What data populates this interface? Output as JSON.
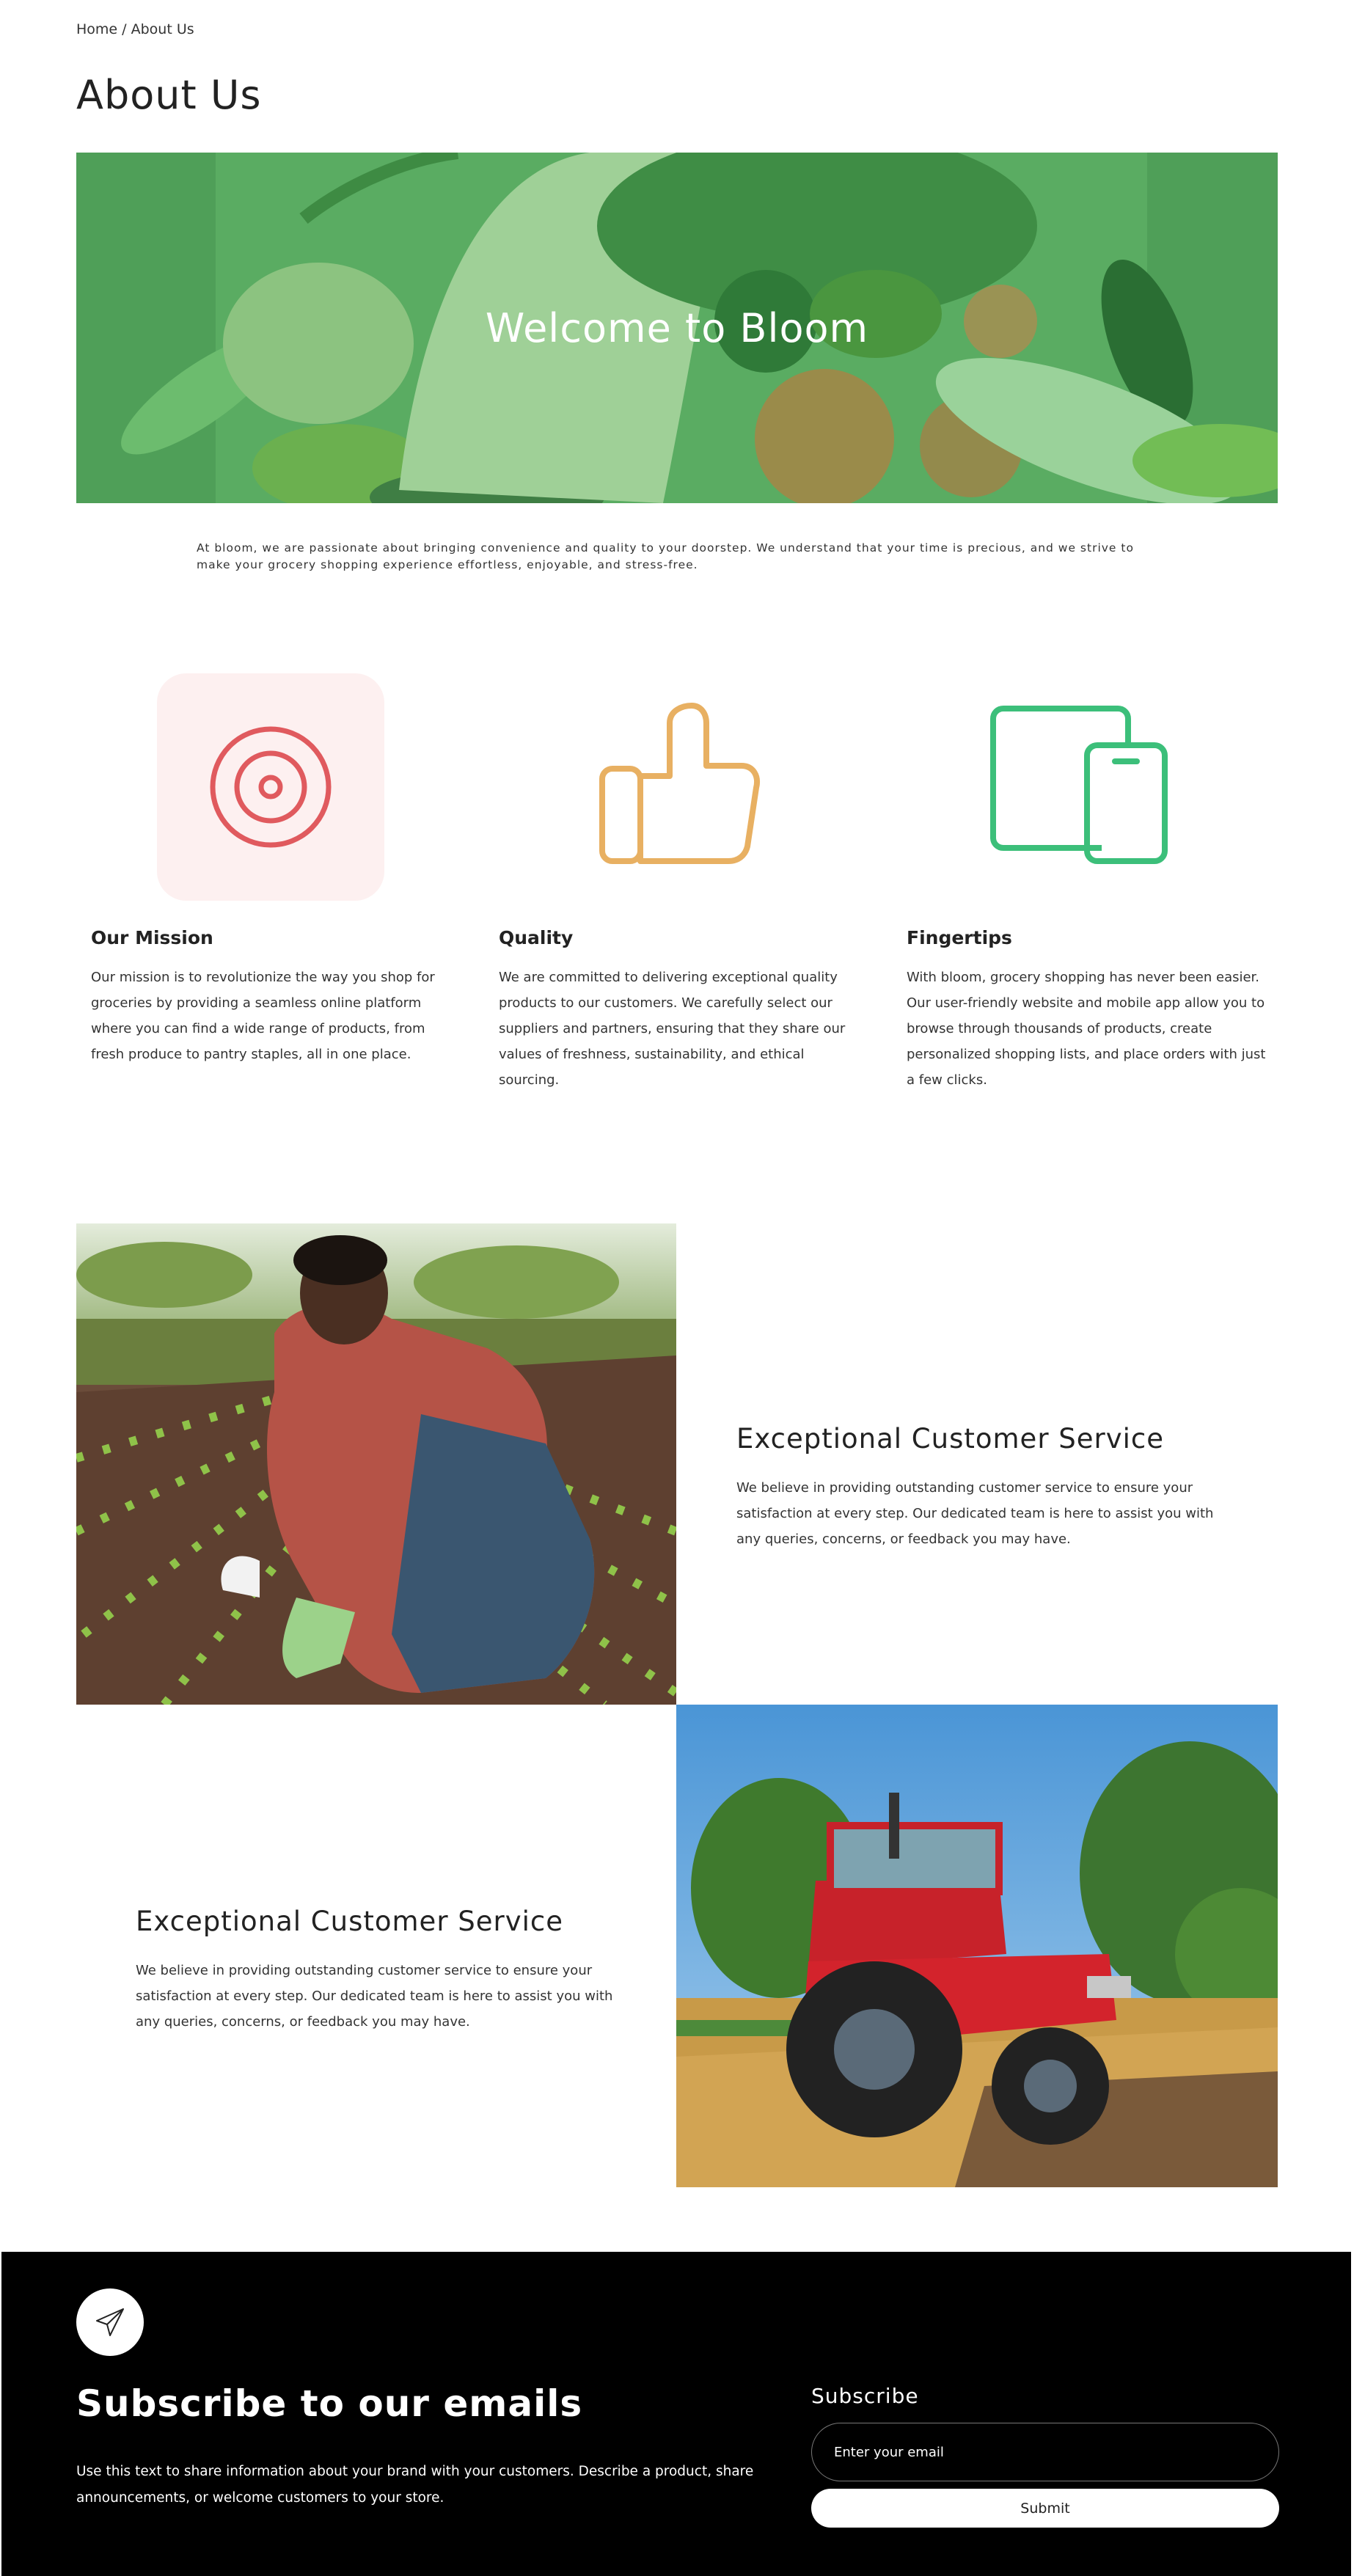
{
  "breadcrumb": {
    "home": "Home",
    "separator": "/",
    "current": "About Us"
  },
  "page_title": "About Us",
  "hero": {
    "title": "Welcome to Bloom",
    "overlay_color": "#4f9f58"
  },
  "intro": "At bloom, we are passionate about bringing convenience and quality to your doorstep. We understand that your time is precious, and we strive to make your grocery shopping experience effortless, enjoyable, and stress-free.",
  "features": [
    {
      "icon": "target-icon",
      "icon_color": "#e05a5e",
      "bg_color": "#fdf0f0",
      "title": "Our Mission",
      "text": "Our mission is to revolutionize the way you shop for groceries by providing a seamless online platform where you can find a wide range of products, from fresh produce to pantry staples, all in one place."
    },
    {
      "icon": "thumbs-up-icon",
      "icon_color": "#e8b062",
      "title": "Quality",
      "text": "We are committed to delivering exceptional quality products to our customers. We carefully select our suppliers and partners, ensuring that they share our values of freshness, sustainability, and ethical sourcing."
    },
    {
      "icon": "devices-icon",
      "icon_color": "#3cbf7a",
      "title": "Fingertips",
      "text": "With bloom, grocery shopping has never been easier. Our user-friendly website and mobile app allow you to browse through thousands of products, create personalized shopping lists, and place orders with just a few clicks."
    }
  ],
  "sections": [
    {
      "image": "farmer-planting-photo",
      "heading": "Exceptional Customer Service",
      "text": "We believe in providing outstanding customer service to ensure your satisfaction at every step. Our dedicated team is here to assist you with any queries, concerns, or feedback you may have."
    },
    {
      "image": "red-tractor-photo",
      "heading": "Exceptional Customer Service",
      "text": "We believe in providing outstanding customer service to ensure your satisfaction at every step. Our dedicated team is here to assist you with any queries, concerns, or feedback you may have."
    }
  ],
  "footer": {
    "icon": "paper-plane-icon",
    "heading": "Subscribe to our emails",
    "text": "Use this text to share information about your brand with your customers. Describe a product, share announcements, or welcome customers to your store.",
    "form_label": "Subscribe",
    "email_placeholder": "Enter your email",
    "submit_label": "Submit"
  }
}
